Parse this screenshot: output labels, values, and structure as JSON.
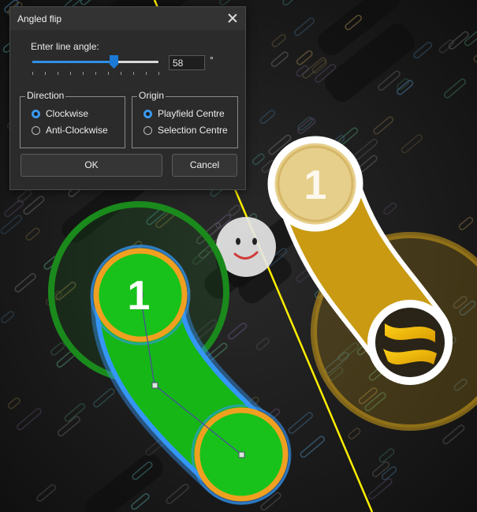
{
  "dialog": {
    "title": "Angled flip",
    "angle_label": "Enter line angle:",
    "slider": {
      "value": 58,
      "min": 0,
      "max": 90
    },
    "angle_value": "58",
    "degree_symbol": "°",
    "direction": {
      "title": "Direction",
      "options": [
        {
          "label": "Clockwise",
          "selected": true
        },
        {
          "label": "Anti-Clockwise",
          "selected": false
        }
      ]
    },
    "origin": {
      "title": "Origin",
      "options": [
        {
          "label": "Playfield Centre",
          "selected": true
        },
        {
          "label": "Selection Centre",
          "selected": false
        }
      ]
    },
    "ok_label": "OK",
    "cancel_label": "Cancel"
  },
  "playfield": {
    "selected_slider_number": "1",
    "flipped_slider_number": "1",
    "colors": {
      "selected_fill": "#18c21a",
      "selected_border": "#f0a020",
      "selection_outline": "#3596f5",
      "flipped_fill": "#e2b321",
      "flip_line": "#ffee00"
    }
  }
}
